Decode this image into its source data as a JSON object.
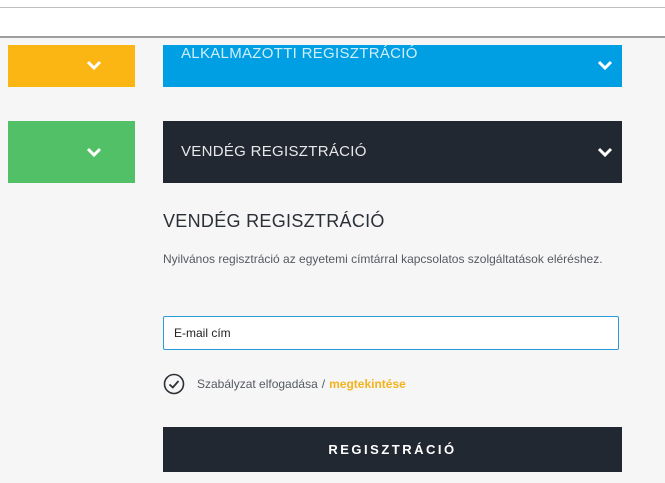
{
  "panels": {
    "employee": {
      "title": "ALKALMAZOTTI REGISZTRÁCIÓ",
      "color": "#009fe3",
      "side_color": "#fcb614"
    },
    "guest": {
      "title": "VENDÉG REGISZTRÁCIÓ",
      "color": "#222831",
      "side_color": "#52c067"
    }
  },
  "form": {
    "title": "VENDÉG REGISZTRÁCIÓ",
    "description": "Nyilvános regisztráció az egyetemi címtárral kapcsolatos szolgáltatások eléréshez.",
    "email_placeholder": "E-mail cím",
    "terms_text": "Szabályzat elfogadása",
    "terms_separator": "/",
    "terms_link": "megtekintése",
    "submit_label": "REGISZTRÁCIÓ"
  },
  "icons": {
    "chevron": "chevron-down-icon",
    "checkmark": "check-circle-icon"
  },
  "colors": {
    "accent_link": "#f4b31e",
    "input_border": "#2a9bd6"
  }
}
